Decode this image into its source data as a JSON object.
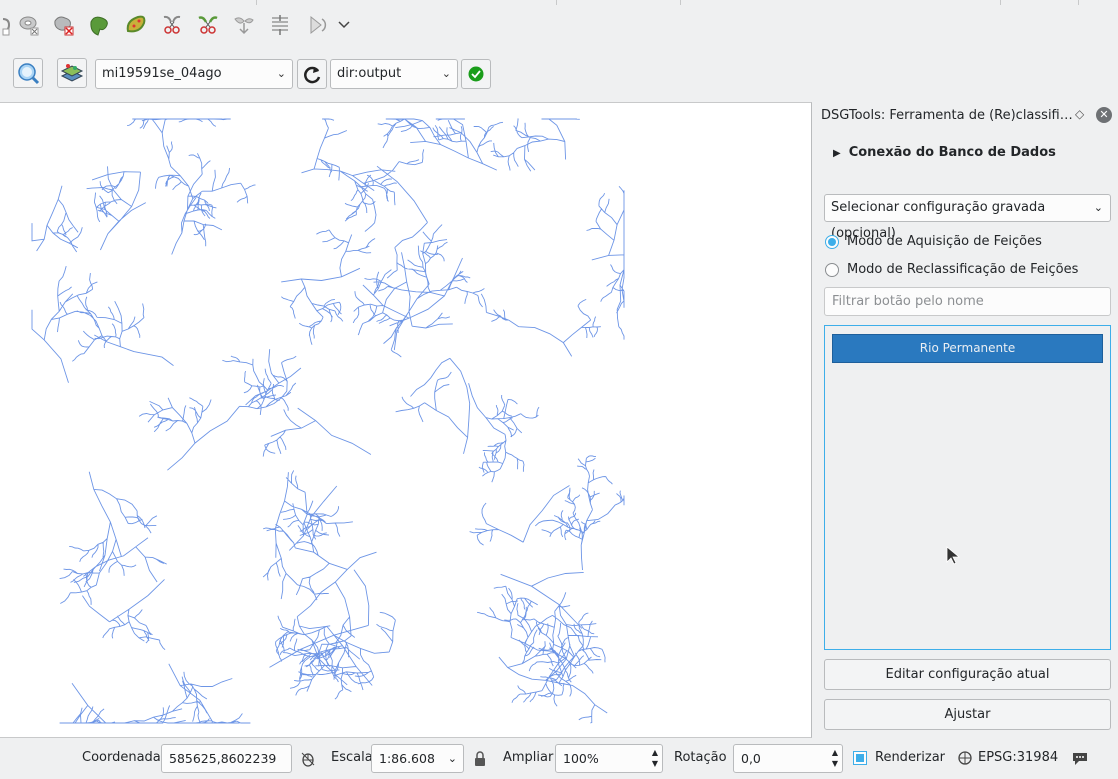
{
  "toolbar": {
    "layer_combo": "mi19591se_04ago",
    "output_combo": "dir:output"
  },
  "dock": {
    "title": "DSGTools: Ferramenta de (Re)classificaç...",
    "db_group": "Conexão do Banco de Dados",
    "config_placeholder": "Selecionar configuração gravada (opcional)",
    "radio_acquisition": "Modo de Aquisição de Feições",
    "radio_reclass": "Modo de Reclassificação de Feições",
    "filter_placeholder": "Filtrar botão pelo nome",
    "buttons": [
      "Rio Permanente"
    ],
    "edit_button": "Editar configuração atual",
    "adjust_button": "Ajustar"
  },
  "status": {
    "coord_label": "Coordenada",
    "coord_value": "585625,8602239",
    "scale_label": "Escala",
    "scale_value": "1:86.608",
    "zoom_label": "Ampliar",
    "zoom_value": "100%",
    "rotation_label": "Rotação",
    "rotation_value": "0,0",
    "render_label": "Renderizar",
    "crs_label": "EPSG:31984"
  },
  "colors": {
    "river": "#6d95e6",
    "accent": "#3daee9",
    "button_active": "#2a79bf"
  }
}
